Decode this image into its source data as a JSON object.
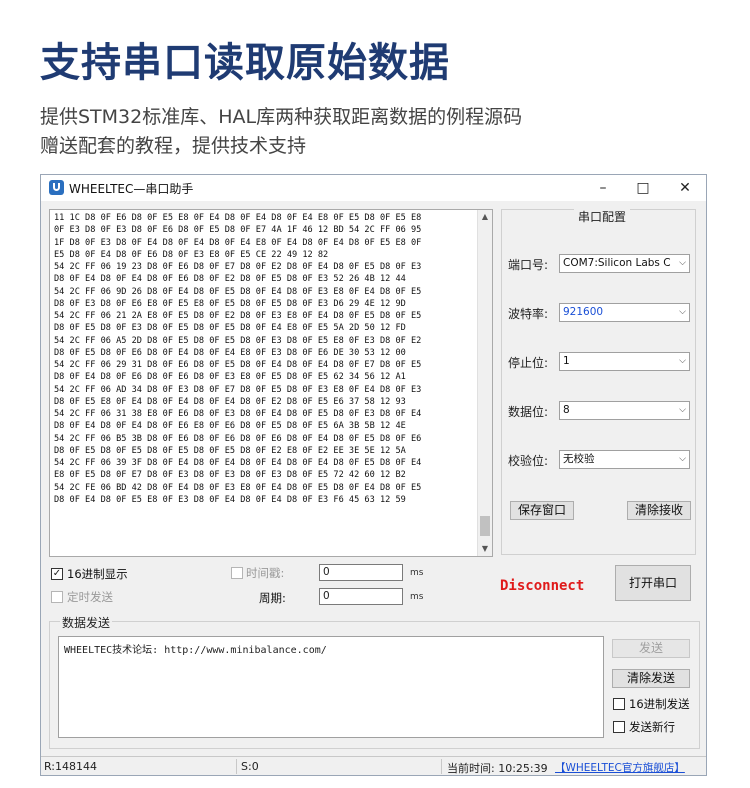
{
  "headline": "支持串口读取原始数据",
  "subtitle": {
    "line1": "提供STM32标准库、HAL库两种获取距离数据的例程源码",
    "line2": "赠送配套的教程，提供技术支持"
  },
  "window": {
    "title": "WHEELTEC—串口助手",
    "minimize": "–",
    "maximize": "□",
    "close": "✕"
  },
  "receive": {
    "lines": [
      "11 1C D8 0F E6 D8 0F E5 E8 0F E4 D8 0F E4 D8 0F E4 E8 0F E5 D8 0F E5 E8",
      "0F E3 D8 0F E3 D8 0F E6 D8 0F E5 D8 0F E7 4A 1F 46 12 BD 54 2C FF 06 95",
      "1F D8 0F E3 D8 0F E4 D8 0F E4 D8 0F E4 E8 0F E4 D8 0F E4 D8 0F E5 E8 0F",
      "E5 D8 0F E4 D8 0F E6 D8 0F E3 E8 0F E5 CE 22 49 12 82",
      "54 2C FF 06 19 23 D8 0F E6 D8 0F E7 D8 0F E2 D8 0F E4 D8 0F E5 D8 0F E3",
      "D8 0F E4 D8 0F E4 D8 0F E6 D8 0F E2 D8 0F E5 D8 0F E3 52 26 4B 12 44",
      "54 2C FF 06 9D 26 D8 0F E4 D8 0F E5 D8 0F E4 D8 0F E3 E8 0F E4 D8 0F E5",
      "D8 0F E3 D8 0F E6 E8 0F E5 E8 0F E5 D8 0F E5 D8 0F E3 D6 29 4E 12 9D",
      "54 2C FF 06 21 2A E8 0F E5 D8 0F E2 D8 0F E3 E8 0F E4 D8 0F E5 D8 0F E5",
      "D8 0F E5 D8 0F E3 D8 0F E5 D8 0F E5 D8 0F E4 E8 0F E5 5A 2D 50 12 FD",
      "54 2C FF 06 A5 2D D8 0F E5 D8 0F E5 D8 0F E3 D8 0F E5 E8 0F E3 D8 0F E2",
      "D8 0F E5 D8 0F E6 D8 0F E4 D8 0F E4 E8 0F E3 D8 0F E6 DE 30 53 12 00",
      "54 2C FF 06 29 31 D8 0F E6 D8 0F E5 D8 0F E4 D8 0F E4 D8 0F E7 D8 0F E5",
      "D8 0F E4 D8 0F E6 D8 0F E6 D8 0F E3 E8 0F E5 D8 0F E5 62 34 56 12 A1",
      "54 2C FF 06 AD 34 D8 0F E3 D8 0F E7 D8 0F E5 D8 0F E3 E8 0F E4 D8 0F E3",
      "D8 0F E5 E8 0F E4 D8 0F E4 D8 0F E4 D8 0F E2 D8 0F E5 E6 37 58 12 93",
      "54 2C FF 06 31 38 E8 0F E6 D8 0F E3 D8 0F E4 D8 0F E5 D8 0F E3 D8 0F E4",
      "D8 0F E4 D8 0F E4 D8 0F E6 E8 0F E6 D8 0F E5 D8 0F E5 6A 3B 5B 12 4E",
      "54 2C FF 06 B5 3B D8 0F E6 D8 0F E6 D8 0F E6 D8 0F E4 D8 0F E5 D8 0F E6",
      "D8 0F E5 D8 0F E5 D8 0F E5 D8 0F E5 D8 0F E2 E8 0F E2 EE 3E 5E 12 5A",
      "54 2C FF 06 39 3F D8 0F E4 D8 0F E4 D8 0F E4 D8 0F E4 D8 0F E5 D8 0F E4",
      "E8 0F E5 D8 0F E7 D8 0F E3 D8 0F E3 D8 0F E3 D8 0F E5 72 42 60 12 B2",
      "54 2C FE 06 BD 42 D8 0F E4 D8 0F E3 E8 0F E4 D8 0F E5 D8 0F E4 D8 0F E5",
      "D8 0F E4 D8 0F E5 E8 0F E3 D8 0F E4 D8 0F E4 D8 0F E3 F6 45 63 12 59"
    ]
  },
  "config": {
    "title": "串口配置",
    "port_label": "端口号:",
    "port_value": "COM7:Silicon Labs C",
    "baud_label": "波特率:",
    "baud_value": "921600",
    "stop_label": "停止位:",
    "stop_value": "1",
    "data_label": "数据位:",
    "data_value": "8",
    "parity_label": "校验位:",
    "parity_value": "无校验",
    "save_button": "保存窗口",
    "clear_receive_button": "清除接收",
    "arrow": "⌵"
  },
  "options": {
    "hex_display": "16进制显示",
    "hex_display_checked": "✓",
    "timed_send": "定时发送",
    "timestamp": "时间戳:",
    "timestamp_value": "0",
    "period": "周期:",
    "period_value": "0",
    "ms": "ms",
    "status_text": "Disconnect",
    "open_port_button": "打开串口"
  },
  "send": {
    "group_title": "数据发送",
    "text": "WHEELTEC技术论坛:  http://www.minibalance.com/",
    "send_button": "发送",
    "clear_send_button": "清除发送",
    "hex_send": "16进制发送",
    "send_newline": "发送新行"
  },
  "statusbar": {
    "received": "R:148144",
    "sent": "S:0",
    "time": "当前时间: 10:25:39",
    "link": "【WHEELTEC官方旗舰店】"
  },
  "colors": {
    "headline": "#1f3b73",
    "disconnect": "#e01a1a",
    "link": "#1a4fd6",
    "baud_value": "#1a4fd6"
  }
}
